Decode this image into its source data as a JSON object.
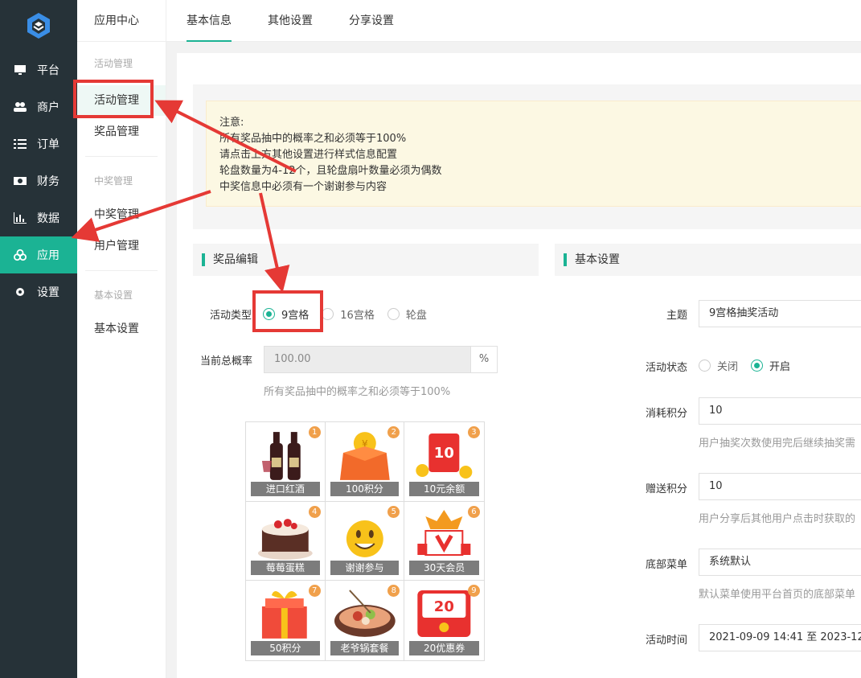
{
  "nav": {
    "items": [
      {
        "label": "平台",
        "icon": "monitor-icon"
      },
      {
        "label": "商户",
        "icon": "users-icon"
      },
      {
        "label": "订单",
        "icon": "list-icon"
      },
      {
        "label": "财务",
        "icon": "money-icon"
      },
      {
        "label": "数据",
        "icon": "bar-chart-icon"
      },
      {
        "label": "应用",
        "icon": "apps-icon",
        "active": true
      },
      {
        "label": "设置",
        "icon": "gear-icon"
      }
    ]
  },
  "submenu": {
    "title": "应用中心",
    "groups": [
      {
        "title": "活动管理",
        "items": [
          "活动管理",
          "奖品管理"
        ]
      },
      {
        "title": "中奖管理",
        "items": [
          "中奖管理",
          "用户管理"
        ]
      },
      {
        "title": "基本设置",
        "items": [
          "基本设置"
        ]
      }
    ]
  },
  "tabs": [
    "基本信息",
    "其他设置",
    "分享设置"
  ],
  "notice": {
    "lines": [
      "注意:",
      "所有奖品抽中的概率之和必须等于100%",
      "请点击上方其他设置进行样式信息配置",
      "轮盘数量为4-12个，且轮盘扇叶数量必须为偶数",
      "中奖信息中必须有一个谢谢参与内容"
    ]
  },
  "prize_edit": {
    "title": "奖品编辑",
    "type_label": "活动类型",
    "types": [
      "9宫格",
      "16宫格",
      "轮盘"
    ],
    "selected_type": "9宫格",
    "prob_label": "当前总概率",
    "prob_value": "100.00",
    "prob_unit": "%",
    "prob_hint": "所有奖品抽中的概率之和必须等于100%",
    "prizes": [
      {
        "n": "1",
        "name": "进口红酒"
      },
      {
        "n": "2",
        "name": "100积分"
      },
      {
        "n": "3",
        "name": "10元余额"
      },
      {
        "n": "4",
        "name": "莓莓蛋糕"
      },
      {
        "n": "5",
        "name": "谢谢参与"
      },
      {
        "n": "6",
        "name": "30天会员"
      },
      {
        "n": "7",
        "name": "50积分"
      },
      {
        "n": "8",
        "name": "老爷锅套餐"
      },
      {
        "n": "9",
        "name": "20优惠券"
      }
    ]
  },
  "basic": {
    "title": "基本设置",
    "theme_label": "主题",
    "theme_value": "9宫格抽奖活动",
    "status_label": "活动状态",
    "status_options": [
      "关闭",
      "开启"
    ],
    "status_selected": "开启",
    "cost_label": "消耗积分",
    "cost_value": "10",
    "cost_hint": "用户抽奖次数使用完后继续抽奖需",
    "gift_label": "赠送积分",
    "gift_value": "10",
    "gift_hint": "用户分享后其他用户点击时获取的",
    "menu_label": "底部菜单",
    "menu_value": "系统默认",
    "menu_hint": "默认菜单使用平台首页的底部菜单",
    "time_label": "活动时间",
    "time_value": "2021-09-09 14:41 至 2023-12-"
  },
  "colors": {
    "accent": "#1bb394",
    "nav_bg": "#263238",
    "annotation": "#e53935"
  }
}
